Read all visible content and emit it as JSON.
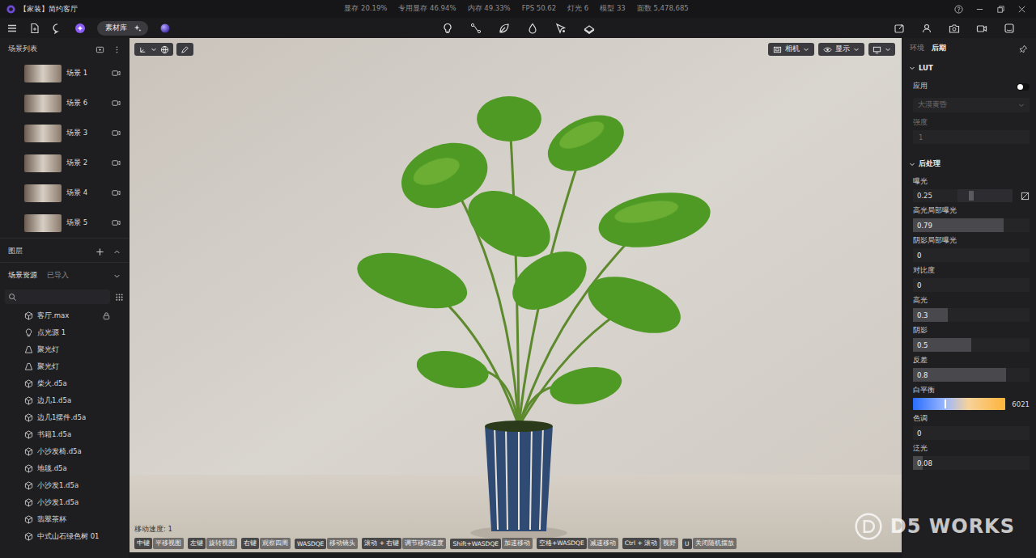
{
  "window": {
    "title": "【家装】简约客厅",
    "stats": [
      "显存 20.19%",
      "专用显存 46.94%",
      "内存 49.33%",
      "FPS 50.62",
      "灯光 6",
      "模型 33",
      "面数 5,478,685"
    ]
  },
  "toolbar": {
    "library_button": "素材库"
  },
  "scene_list": {
    "title": "场景列表",
    "scenes": [
      {
        "name": "场景 1",
        "selected": false
      },
      {
        "name": "场景 6",
        "selected": false
      },
      {
        "name": "场景 3",
        "selected": false
      },
      {
        "name": "场景 2",
        "selected": false
      },
      {
        "name": "场景 4",
        "selected": false
      },
      {
        "name": "场景 5",
        "selected": false
      }
    ]
  },
  "layers": {
    "title": "图层"
  },
  "resources": {
    "tabs": [
      {
        "label": "场景资源",
        "selected": true
      },
      {
        "label": "已导入",
        "selected": false
      }
    ],
    "items": [
      {
        "name": "客厅.max",
        "kind": "model",
        "locked": true
      },
      {
        "name": "点光源 1",
        "kind": "light",
        "locked": false
      },
      {
        "name": "聚光灯",
        "kind": "spot",
        "locked": false
      },
      {
        "name": "聚光灯",
        "kind": "spot",
        "locked": false
      },
      {
        "name": "柴火.d5a",
        "kind": "model",
        "locked": false
      },
      {
        "name": "边几1.d5a",
        "kind": "model",
        "locked": false
      },
      {
        "name": "边几1摆件.d5a",
        "kind": "model",
        "locked": false
      },
      {
        "name": "书籍1.d5a",
        "kind": "model",
        "locked": false
      },
      {
        "name": "小沙发椅.d5a",
        "kind": "model",
        "locked": false
      },
      {
        "name": "地毯.d5a",
        "kind": "model",
        "locked": false
      },
      {
        "name": "小沙发1.d5a",
        "kind": "model",
        "locked": false
      },
      {
        "name": "小沙发1.d5a",
        "kind": "model",
        "locked": false
      },
      {
        "name": "翡翠茶杯",
        "kind": "model",
        "locked": false
      },
      {
        "name": "中式山石绿色树 01",
        "kind": "model",
        "locked": false
      }
    ]
  },
  "viewport": {
    "camera_button": "相机",
    "display_button": "显示",
    "move_speed": "移动速度: 1",
    "hints": [
      {
        "key": "中键",
        "action": "平移视图"
      },
      {
        "key": "左键",
        "action": "旋转视图"
      },
      {
        "key": "右键",
        "action": "观察四周"
      },
      {
        "key": "WASDQE",
        "action": "移动镜头"
      },
      {
        "key": "滚动 + 右键",
        "action": "调节移动速度"
      },
      {
        "key": "Shift+WASDQE",
        "action": "加速移动"
      },
      {
        "key": "空格+WASDQE",
        "action": "减速移动"
      },
      {
        "key": "Ctrl + 滚动",
        "action": "视野"
      },
      {
        "key": "U",
        "action": "关闭随机摆放"
      }
    ]
  },
  "watermark": "D5 WORKS",
  "right_panel": {
    "tabs": [
      {
        "label": "环境",
        "selected": false
      },
      {
        "label": "后期",
        "selected": true
      }
    ],
    "lut": {
      "title": "LUT",
      "apply_label": "应用",
      "apply_on": false,
      "preset": "大漠黄昏",
      "strength_label": "强度",
      "strength": "1",
      "disabled": true
    },
    "post": {
      "title": "后处理",
      "params": [
        {
          "label": "曝光",
          "value": "0.25",
          "kind": "slider",
          "level": 0.2
        },
        {
          "label": "高光局部曝光",
          "value": "0.79",
          "kind": "bar",
          "level": 0.78
        },
        {
          "label": "阴影局部曝光",
          "value": "0",
          "kind": "bar",
          "level": 0
        },
        {
          "label": "对比度",
          "value": "0",
          "kind": "bar",
          "level": 0
        },
        {
          "label": "高光",
          "value": "0.3",
          "kind": "bar",
          "level": 0.3
        },
        {
          "label": "阴影",
          "value": "0.5",
          "kind": "bar",
          "level": 0.5
        },
        {
          "label": "反差",
          "value": "0.8",
          "kind": "bar",
          "level": 0.8
        },
        {
          "label": "白平衡",
          "value": "6021",
          "kind": "temperature",
          "level": 0.34
        },
        {
          "label": "色调",
          "value": "0",
          "kind": "bar",
          "level": 0
        },
        {
          "label": "泛光",
          "value": "0.08",
          "kind": "bar",
          "level": 0.08
        }
      ]
    }
  }
}
